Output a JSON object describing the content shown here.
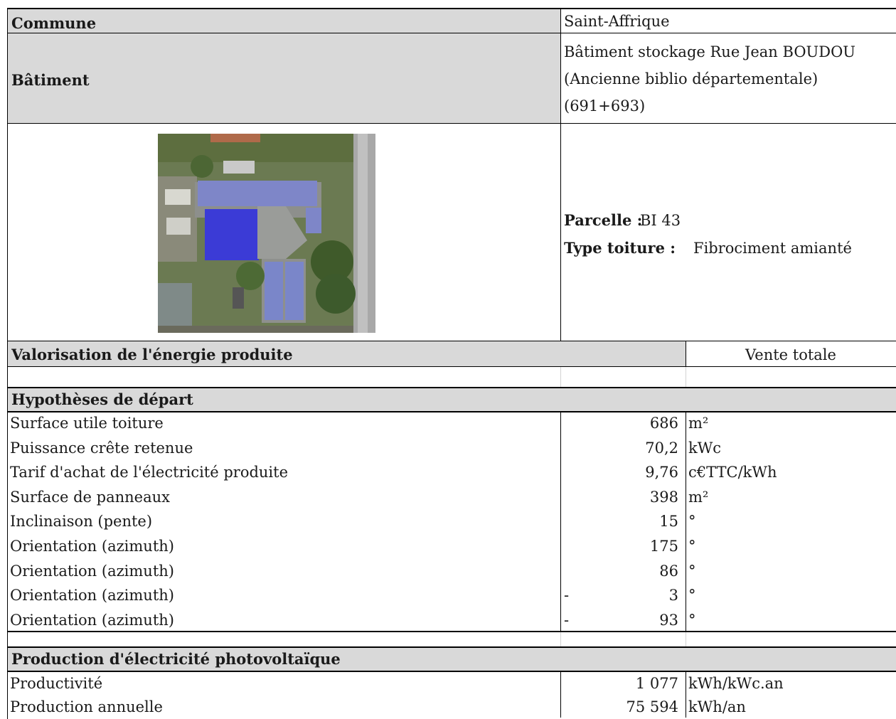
{
  "header": {
    "commune_label": "Commune",
    "commune_value": "Saint-Affrique",
    "batiment_label": "Bâtiment",
    "batiment_lines": [
      "Bâtiment stockage Rue Jean BOUDOU",
      "(Ancienne biblio départementale)",
      "(691+693)"
    ]
  },
  "details": {
    "parcelle_label": "Parcelle :",
    "parcelle_value": "BI 43",
    "toiture_label": "Type toiture :",
    "toiture_value": "Fibrociment amianté"
  },
  "valorisation": {
    "label": "Valorisation de l'énergie produite",
    "value": "Vente totale"
  },
  "hypotheses": {
    "title": "Hypothèses de départ",
    "rows": [
      {
        "label": "Surface utile toiture",
        "sign": "",
        "value": "686",
        "unit": "m²"
      },
      {
        "label": "Puissance crête retenue",
        "sign": "",
        "value": "70,2",
        "unit": "kWc"
      },
      {
        "label": "Tarif d'achat de l'électricité produite",
        "sign": "",
        "value": "9,76",
        "unit": "c€TTC/kWh"
      },
      {
        "label": "Surface de panneaux",
        "sign": "",
        "value": "398",
        "unit": "m²"
      },
      {
        "label": "Inclinaison (pente)",
        "sign": "",
        "value": "15",
        "unit": "°"
      },
      {
        "label": "Orientation (azimuth)",
        "sign": "",
        "value": "175",
        "unit": "°"
      },
      {
        "label": "Orientation (azimuth)",
        "sign": "",
        "value": "86",
        "unit": "°"
      },
      {
        "label": "Orientation (azimuth)",
        "sign": "-",
        "value": "3",
        "unit": "°"
      },
      {
        "label": "Orientation (azimuth)",
        "sign": "-",
        "value": "93",
        "unit": "°"
      }
    ]
  },
  "production": {
    "title": "Production d'électricité photovoltaïque",
    "rows": [
      {
        "label": "Productivité",
        "value": "1 077",
        "unit": "kWh/kWc.an"
      },
      {
        "label": "Production annuelle",
        "value": "75 594",
        "unit": "kWh/an"
      }
    ]
  },
  "colors": {
    "header_grey": "#d9d9d9",
    "panel_blue": "#3b3bd6",
    "panel_light": "#7a86c9"
  }
}
